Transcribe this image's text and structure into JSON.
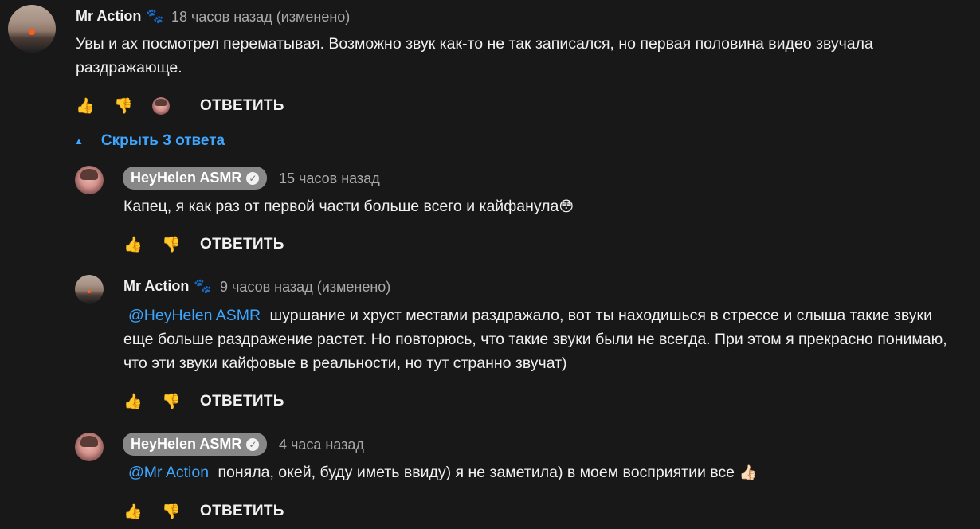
{
  "comments": [
    {
      "author": "Mr Action",
      "author_icon": "paw-icon",
      "time": "18 часов назад (изменено)",
      "text": "Увы и ах посмотрел перематывая. Возможно звук как-то не так записался, но первая половина видео звучала раздражающе.",
      "reply_label": "ОТВЕТИТЬ"
    }
  ],
  "replies_toggle": {
    "label": "Скрыть 3 ответа"
  },
  "replies": [
    {
      "author": "HeyHelen ASMR",
      "verified": true,
      "time": "15 часов назад",
      "text": "Капец, я как раз от первой части больше всего и кайфанула",
      "emoji": "😳",
      "reply_label": "ОТВЕТИТЬ"
    },
    {
      "author": "Mr Action",
      "time": "9 часов назад (изменено)",
      "mention": "@HeyHelen ASMR",
      "text": "шуршание и хруст местами раздражало, вот ты находишься в стрессе и слыша такие звуки еще больше раздражение растет. Но повторюсь, что  такие звуки были не всегда. При этом я прекрасно понимаю, что эти звуки кайфовые в реальности, но тут странно звучат)",
      "reply_label": "ОТВЕТИТЬ"
    },
    {
      "author": "HeyHelen ASMR",
      "verified": true,
      "time": "4 часа назад",
      "mention": "@Mr Action",
      "text": "поняла, окей, буду иметь ввиду) я не заметила) в моем восприятии все",
      "emoji": "👍🏻",
      "reply_label": "ОТВЕТИТЬ"
    }
  ],
  "colors": {
    "background": "#181818",
    "link": "#3ea6ff",
    "secondary_text": "#aaaaaa",
    "heart": "#ff2e2e"
  }
}
